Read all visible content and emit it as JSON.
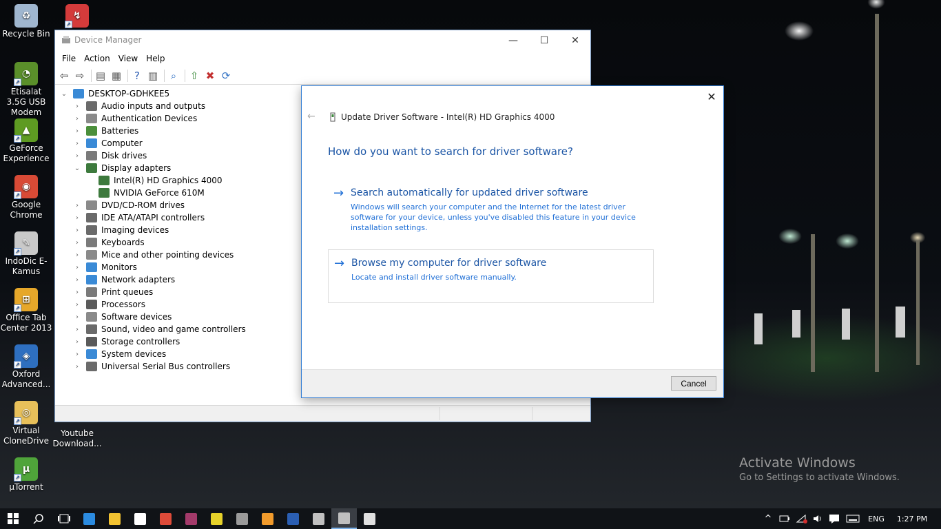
{
  "desktop": {
    "icons": [
      {
        "label": "Recycle Bin",
        "color": "#9fb6cf"
      },
      {
        "label": "Etisalat 3.5G USB Modem",
        "color": "#5a8f2a"
      },
      {
        "label": "GeForce Experience",
        "color": "#5e9b22"
      },
      {
        "label": "Google Chrome",
        "color": "#d84a36"
      },
      {
        "label": "IndoDic E-Kamus",
        "color": "#c9c9c9"
      },
      {
        "label": "Office Tab Center 2013",
        "color": "#e6a72a"
      },
      {
        "label": "Oxford Advanced...",
        "color": "#2e6fc0"
      },
      {
        "label": "Virtual CloneDrive",
        "color": "#e8c05a"
      },
      {
        "label": "µTorrent",
        "color": "#4fa43a"
      },
      {
        "label": "Youtube Download...",
        "color": "#d43b3b"
      }
    ],
    "watermark_title": "Activate Windows",
    "watermark_subtitle": "Go to Settings to activate Windows."
  },
  "device_manager": {
    "title": "Device Manager",
    "minimize": "—",
    "maximize": "☐",
    "close": "✕",
    "menu": [
      "File",
      "Action",
      "View",
      "Help"
    ],
    "toolbar": [
      {
        "name": "back-icon",
        "glyph": "⇦",
        "color": "#4a4a4a"
      },
      {
        "name": "forward-icon",
        "glyph": "⇨",
        "color": "#4a4a4a"
      },
      {
        "name": "properties-icon",
        "glyph": "▤",
        "color": "#5a5a5a"
      },
      {
        "name": "view-icon",
        "glyph": "▦",
        "color": "#5a5a5a"
      },
      {
        "name": "help-icon",
        "glyph": "?",
        "color": "#2f5fb3"
      },
      {
        "name": "grid-icon",
        "glyph": "▥",
        "color": "#5a5a5a"
      },
      {
        "name": "scan-icon",
        "glyph": "⌕",
        "color": "#3a78c7"
      },
      {
        "name": "update-driver-icon",
        "glyph": "⇧",
        "color": "#3f8d3f"
      },
      {
        "name": "uninstall-icon",
        "glyph": "✖",
        "color": "#c23030"
      },
      {
        "name": "scan-hardware-icon",
        "glyph": "⟳",
        "color": "#3a78c7"
      }
    ],
    "tree": {
      "root": "DESKTOP-GDHKEE5",
      "categories": [
        {
          "label": "Audio inputs and outputs",
          "icon_color": "#6a6a6a"
        },
        {
          "label": "Authentication Devices",
          "icon_color": "#8a8a8a"
        },
        {
          "label": "Batteries",
          "icon_color": "#4b8f3b"
        },
        {
          "label": "Computer",
          "icon_color": "#3a8ad6"
        },
        {
          "label": "Disk drives",
          "icon_color": "#7a7a7a"
        },
        {
          "label": "Display adapters",
          "icon_color": "#3d7a3d",
          "expanded": true,
          "children": [
            "Intel(R) HD Graphics 4000",
            "NVIDIA GeForce 610M"
          ]
        },
        {
          "label": "DVD/CD-ROM drives",
          "icon_color": "#8a8a8a"
        },
        {
          "label": "IDE ATA/ATAPI controllers",
          "icon_color": "#6a6a6a"
        },
        {
          "label": "Imaging devices",
          "icon_color": "#6a6a6a"
        },
        {
          "label": "Keyboards",
          "icon_color": "#7a7a7a"
        },
        {
          "label": "Mice and other pointing devices",
          "icon_color": "#8a8a8a"
        },
        {
          "label": "Monitors",
          "icon_color": "#3a8ad6"
        },
        {
          "label": "Network adapters",
          "icon_color": "#3a8ad6"
        },
        {
          "label": "Print queues",
          "icon_color": "#7a7a7a"
        },
        {
          "label": "Processors",
          "icon_color": "#5a5a5a"
        },
        {
          "label": "Software devices",
          "icon_color": "#8a8a8a"
        },
        {
          "label": "Sound, video and game controllers",
          "icon_color": "#6a6a6a"
        },
        {
          "label": "Storage controllers",
          "icon_color": "#5a5a5a"
        },
        {
          "label": "System devices",
          "icon_color": "#3a8ad6"
        },
        {
          "label": "Universal Serial Bus controllers",
          "icon_color": "#6a6a6a"
        }
      ]
    }
  },
  "update_dialog": {
    "close": "✕",
    "back": "←",
    "header_title": "Update Driver Software - Intel(R) HD Graphics 4000",
    "question": "How do you want to search for driver software?",
    "options": [
      {
        "title": "Search automatically for updated driver software",
        "description": "Windows will search your computer and the Internet for the latest driver software for your device, unless you've disabled this feature in your device installation settings."
      },
      {
        "title": "Browse my computer for driver software",
        "description": "Locate and install driver software manually."
      }
    ],
    "cancel_label": "Cancel",
    "accent_color": "#1b55a5"
  },
  "taskbar": {
    "apps": [
      {
        "name": "start-button-icon",
        "color": "#ffffff"
      },
      {
        "name": "search-icon",
        "color": "#ffffff"
      },
      {
        "name": "task-view-icon",
        "color": "#ffffff"
      },
      {
        "name": "edge-icon",
        "color": "#2b8be0"
      },
      {
        "name": "file-explorer-icon",
        "color": "#f2c231"
      },
      {
        "name": "store-icon",
        "color": "#ffffff"
      },
      {
        "name": "chrome-icon",
        "color": "#dd4b39"
      },
      {
        "name": "winrar-icon",
        "color": "#a33a6a"
      },
      {
        "name": "app-icon",
        "color": "#e6d22a"
      },
      {
        "name": "cmd-icon",
        "color": "#9a9a9a"
      },
      {
        "name": "media-player-icon",
        "color": "#f19b2c"
      },
      {
        "name": "word-icon",
        "color": "#2b5fb3"
      },
      {
        "name": "settings-app-icon",
        "color": "#c0c0c0"
      },
      {
        "name": "device-manager-icon",
        "color": "#bfbfbf",
        "active": true
      },
      {
        "name": "paint-icon",
        "color": "#e0e0e0"
      }
    ],
    "language": "ENG",
    "time": "1:27 PM"
  }
}
